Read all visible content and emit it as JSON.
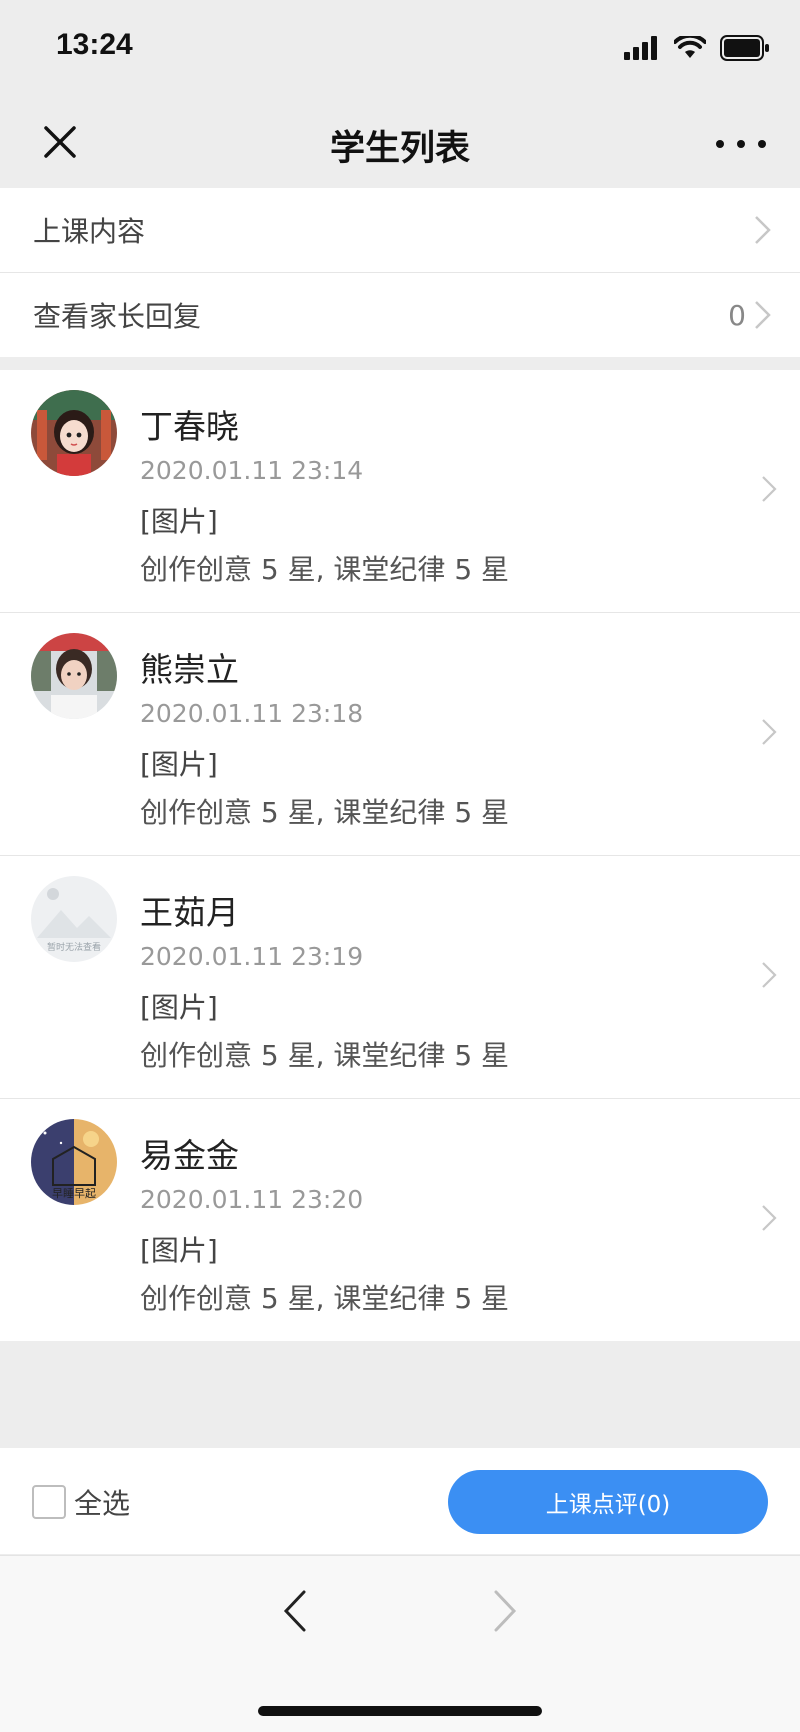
{
  "status_bar": {
    "time": "13:24"
  },
  "nav": {
    "title": "学生列表"
  },
  "menu": {
    "class_content": "上课内容",
    "parent_reply": "查看家长回复",
    "parent_reply_count": "0"
  },
  "students": [
    {
      "name": "丁春晓",
      "time": "2020.01.11 23:14",
      "attachment": "[图片]",
      "rating": "创作创意 5 星, 课堂纪律 5 星"
    },
    {
      "name": "熊崇立",
      "time": "2020.01.11 23:18",
      "attachment": "[图片]",
      "rating": "创作创意 5 星, 课堂纪律 5 星"
    },
    {
      "name": "王茹月",
      "time": "2020.01.11 23:19",
      "attachment": "[图片]",
      "rating": "创作创意 5 星, 课堂纪律 5 星"
    },
    {
      "name": "易金金",
      "time": "2020.01.11 23:20",
      "attachment": "[图片]",
      "rating": "创作创意 5 星, 课堂纪律 5 星"
    }
  ],
  "placeholder_avatar_text": "暂时无法查看",
  "avatar_4_text": "早睡早起",
  "bottom": {
    "select_all": "全选",
    "review_button": "上课点评(0)"
  },
  "colors": {
    "accent": "#3b8ff3",
    "background": "#ededed"
  }
}
